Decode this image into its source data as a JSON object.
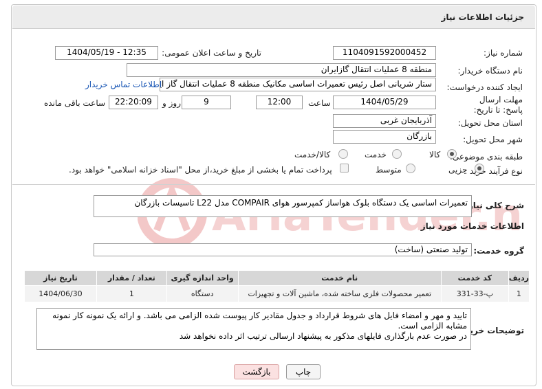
{
  "header": {
    "title": "جزئیات اطلاعات نیاز"
  },
  "watermark": {
    "text": "AriaTender.neT",
    "color": "#f0b9b9"
  },
  "form": {
    "need_number_label": "شماره نیاز:",
    "need_number": "1104091592000452",
    "announce_label": "تاریخ و ساعت اعلان عمومی:",
    "announce_value": "1404/05/19 - 12:35",
    "buyer_label": "نام دستگاه خریدار:",
    "buyer_value": "منطقه 8 عملیات انتقال گازایران",
    "creator_label": "ایجاد کننده درخواست:",
    "creator_value": "ستار شریانی اصل رئیس تعمیرات اساسی مکانیک منطقه 8 عملیات انتقال گاز ایران",
    "contact_link": "اطلاعات تماس خریدار",
    "deadline_label": "مهلت ارسال پاسخ: تا تاریخ:",
    "deadline_date": "1404/05/29",
    "time_label": "ساعت",
    "deadline_time": "12:00",
    "days_value": "9",
    "days_label": "روز و",
    "remaining_time": "22:20:09",
    "remaining_label": "ساعت باقی مانده",
    "province_label": "استان محل تحویل:",
    "province_value": "آذربایجان غربی",
    "city_label": "شهر محل تحویل:",
    "city_value": "بازرگان",
    "category_label": "طبقه بندی موضوعی:",
    "category_options": {
      "goods": "کالا",
      "service": "خدمت",
      "goods_service": "کالا/خدمت"
    },
    "process_label": "نوع فرآیند خرید :",
    "process_options": {
      "minor": "جزیی",
      "medium": "متوسط"
    },
    "payment_note": "پرداخت تمام یا بخشی از مبلغ خرید،از محل \"اسناد خزانه اسلامی\" خواهد بود."
  },
  "summary": {
    "label": "شرح کلی نیاز:",
    "text": "تعمیرات اساسی یک دستگاه بلوک هواساز کمپرسور هوای COMPAIR مدل L22 تاسیسات بازرگان"
  },
  "services": {
    "section_title": "اطلاعات خدمات مورد نیاز",
    "group_label": "گروه خدمت:",
    "group_value": "تولید صنعتی (ساخت)",
    "columns": [
      "ردیف",
      "کد خدمت",
      "نام خدمت",
      "واحد اندازه گیری",
      "تعداد / مقدار",
      "تاریخ نیاز"
    ],
    "rows": [
      {
        "row": "1",
        "code": "پ-33-331",
        "name": "تعمیر محصولات فلزی ساخته شده، ماشین آلات و تجهیزات",
        "unit": "دستگاه",
        "qty": "1",
        "date": "1404/06/30"
      }
    ]
  },
  "buyer_notes": {
    "label": "توضیحات خریدار:",
    "line1": "تایید و مهر و امضاء فایل های شروط قرارداد و جدول مقادیر کار پیوست شده الزامی می باشد. و  ارائه یک نمونه  کار نمونه مشابه الزامی است.",
    "line2": "در صورت عدم بارگذاری فایلهای مذکور به پیشنهاد ارسالی ترتیب اثر داده نخواهد شد"
  },
  "buttons": {
    "print": "چاپ",
    "back": "بازگشت"
  }
}
